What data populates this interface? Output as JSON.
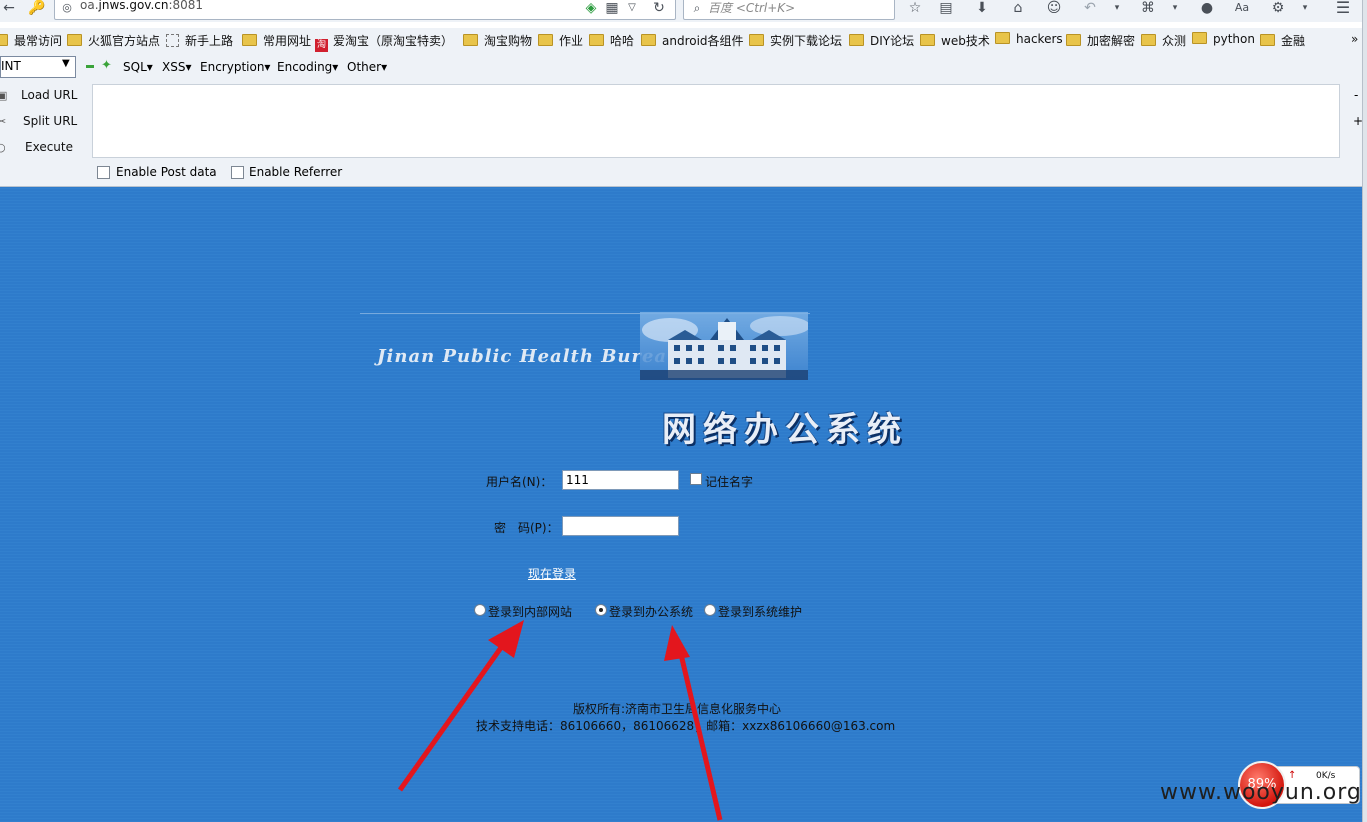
{
  "browser": {
    "url": "oa.jnws.gov.cn:8081",
    "url_domain": "jnws.gov.cn",
    "url_prefix": "oa.",
    "url_suffix": ":8081",
    "search_placeholder": "百度 <Ctrl+K>"
  },
  "bookmarks": [
    "最常访问",
    "火狐官方站点",
    "新手上路",
    "常用网址",
    "爱淘宝（原淘宝特卖）",
    "淘宝购物",
    "作业",
    "哈哈",
    "android各组件",
    "实例下载论坛",
    "DIY论坛",
    "web技术",
    "hackers",
    "加密解密",
    "众测",
    "python",
    "金融"
  ],
  "bookmarks_overflow": "»",
  "hackbar": {
    "select_value": "INT",
    "menus": [
      "SQL▾",
      "XSS▾",
      "Encryption▾",
      "Encoding▾",
      "Other▾"
    ],
    "buttons": {
      "load": "Load URL",
      "split": "Split URL",
      "execute": "Execute"
    },
    "enable_post": "Enable Post data",
    "enable_referrer": "Enable Referrer",
    "minus": "-",
    "plus": "+"
  },
  "page": {
    "banner_text": "Jinan Public Health Bureau",
    "system_title": "网络办公系统",
    "username_label": "用户名(N)：",
    "username_value": "111",
    "remember_label": "记住名字",
    "password_label": "密　码(P)：",
    "login_link": "现在登录",
    "radio_options": [
      {
        "label": "登录到内部网站",
        "checked": false
      },
      {
        "label": "登录到办公系统",
        "checked": true
      },
      {
        "label": "登录到系统维护",
        "checked": false
      }
    ],
    "footer_line1": "版权所有:济南市卫生局信息化服务中心",
    "footer_line2": "技术支持电话：86106660，86106628；邮箱：xxzx86106660@163.com"
  },
  "speed_widget": {
    "percent": "89%",
    "speed": "0K/s"
  },
  "watermark": "www.wooyun.org",
  "colors": {
    "page_bg": "#2e7bcb",
    "arrow": "#e3161d",
    "chrome": "#eef2f7"
  }
}
